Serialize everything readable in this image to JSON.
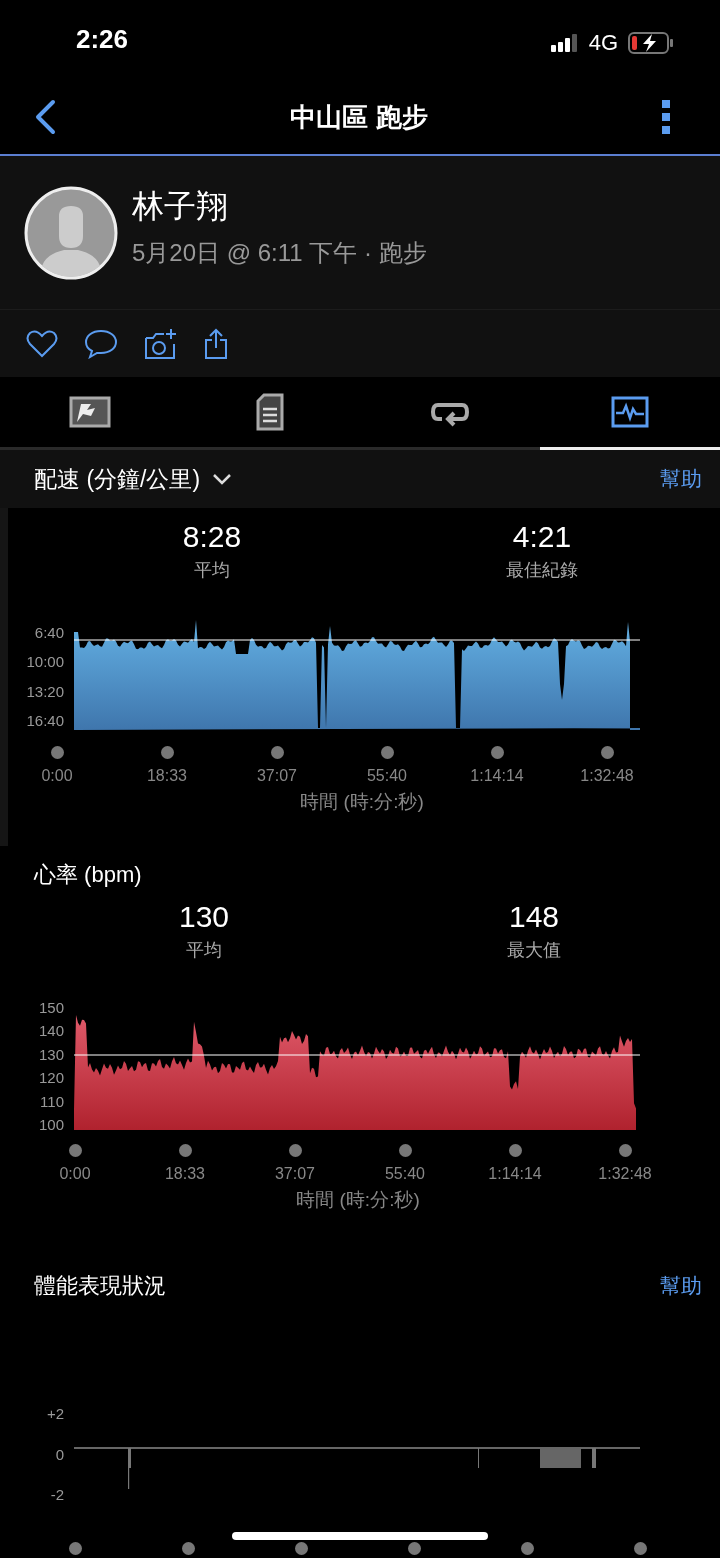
{
  "status_bar": {
    "time": "2:26",
    "network": "4G"
  },
  "nav": {
    "title": "中山區 跑步"
  },
  "profile": {
    "name": "林子翔",
    "subtitle": "5月20日 @ 6:11 下午 · 跑步"
  },
  "tabs": [
    {
      "kind": "map",
      "selected": false
    },
    {
      "kind": "document",
      "selected": false
    },
    {
      "kind": "laps",
      "selected": false
    },
    {
      "kind": "chart",
      "selected": true
    }
  ],
  "pace": {
    "metric": "配速 (分鐘/公里)",
    "help": "幫助",
    "stats": [
      {
        "value": "8:28",
        "label": "平均"
      },
      {
        "value": "4:21",
        "label": "最佳紀錄"
      }
    ],
    "y_ticks": [
      "6:40",
      "10:00",
      "13:20",
      "16:40"
    ],
    "x_ticks": [
      "0:00",
      "18:33",
      "37:07",
      "55:40",
      "1:14:14",
      "1:32:48"
    ],
    "x_label": "時間 (時:分:秒)"
  },
  "heart_rate": {
    "title": "心率 (bpm)",
    "stats": [
      {
        "value": "130",
        "label": "平均"
      },
      {
        "value": "148",
        "label": "最大值"
      }
    ],
    "y_ticks": [
      "150",
      "140",
      "130",
      "120",
      "110",
      "100"
    ],
    "x_ticks": [
      "0:00",
      "18:33",
      "37:07",
      "55:40",
      "1:14:14",
      "1:32:48"
    ],
    "x_label": "時間 (時:分:秒)"
  },
  "performance": {
    "title": "體能表現狀況",
    "help": "幫助",
    "y_ticks": [
      "+2",
      "0",
      "-2"
    ]
  }
}
